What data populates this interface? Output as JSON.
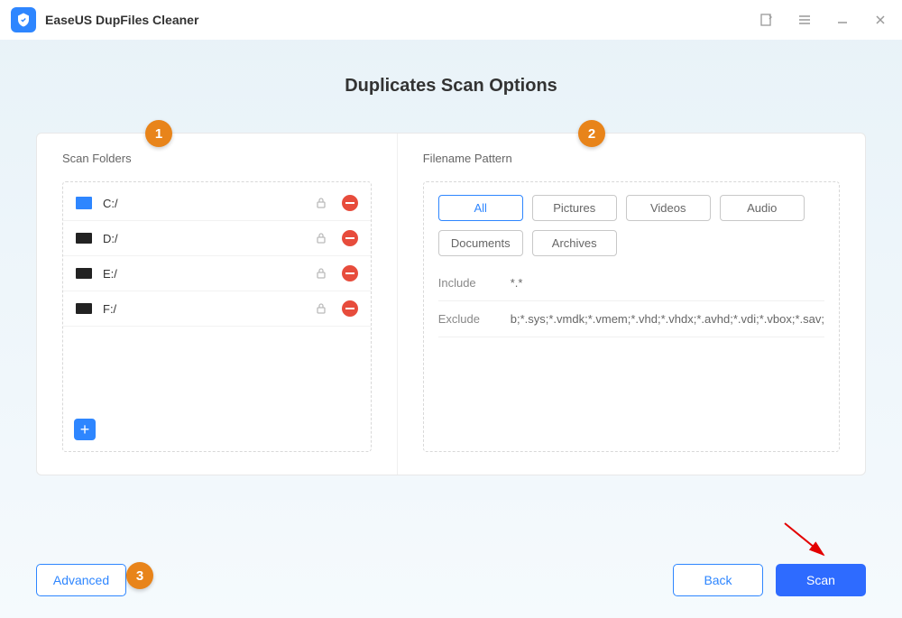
{
  "app": {
    "title": "EaseUS DupFiles Cleaner"
  },
  "page": {
    "title": "Duplicates Scan Options"
  },
  "markers": {
    "m1": "1",
    "m2": "2",
    "m3": "3"
  },
  "scan": {
    "title": "Scan Folders",
    "folders": [
      "C:/",
      "D:/",
      "E:/",
      "F:/"
    ]
  },
  "pattern": {
    "title": "Filename Pattern",
    "cats": [
      "All",
      "Pictures",
      "Videos",
      "Audio",
      "Documents",
      "Archives"
    ],
    "include_label": "Include",
    "include_value": "*.*",
    "exclude_label": "Exclude",
    "exclude_value": "b;*.sys;*.vmdk;*.vmem;*.vhd;*.vhdx;*.avhd;*.vdi;*.vbox;*.sav;"
  },
  "footer": {
    "advanced": "Advanced",
    "back": "Back",
    "scan": "Scan"
  }
}
